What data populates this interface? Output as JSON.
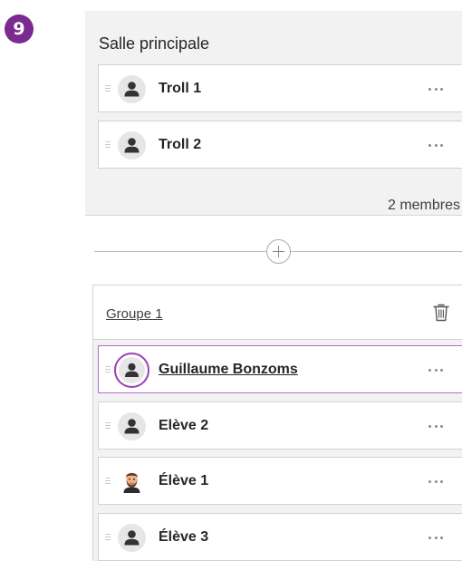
{
  "step": {
    "number": "9"
  },
  "main_room": {
    "title": "Salle principale",
    "members": [
      {
        "name": "Troll 1",
        "avatar": "person-icon"
      },
      {
        "name": "Troll 2",
        "avatar": "person-icon"
      }
    ],
    "count_label": "2 membres"
  },
  "group": {
    "name": "Groupe 1",
    "members": [
      {
        "name": "Guillaume Bonzoms",
        "avatar": "person-icon",
        "highlighted": true
      },
      {
        "name": "Elève 2",
        "avatar": "person-icon"
      },
      {
        "name": "Élève 1",
        "avatar": "bearded-man-emoji"
      },
      {
        "name": "Élève 3",
        "avatar": "person-icon"
      }
    ]
  },
  "colors": {
    "accent": "#7b2a8f",
    "highlight_border": "#b66ac9",
    "panel_bg": "#f2f2f2"
  }
}
